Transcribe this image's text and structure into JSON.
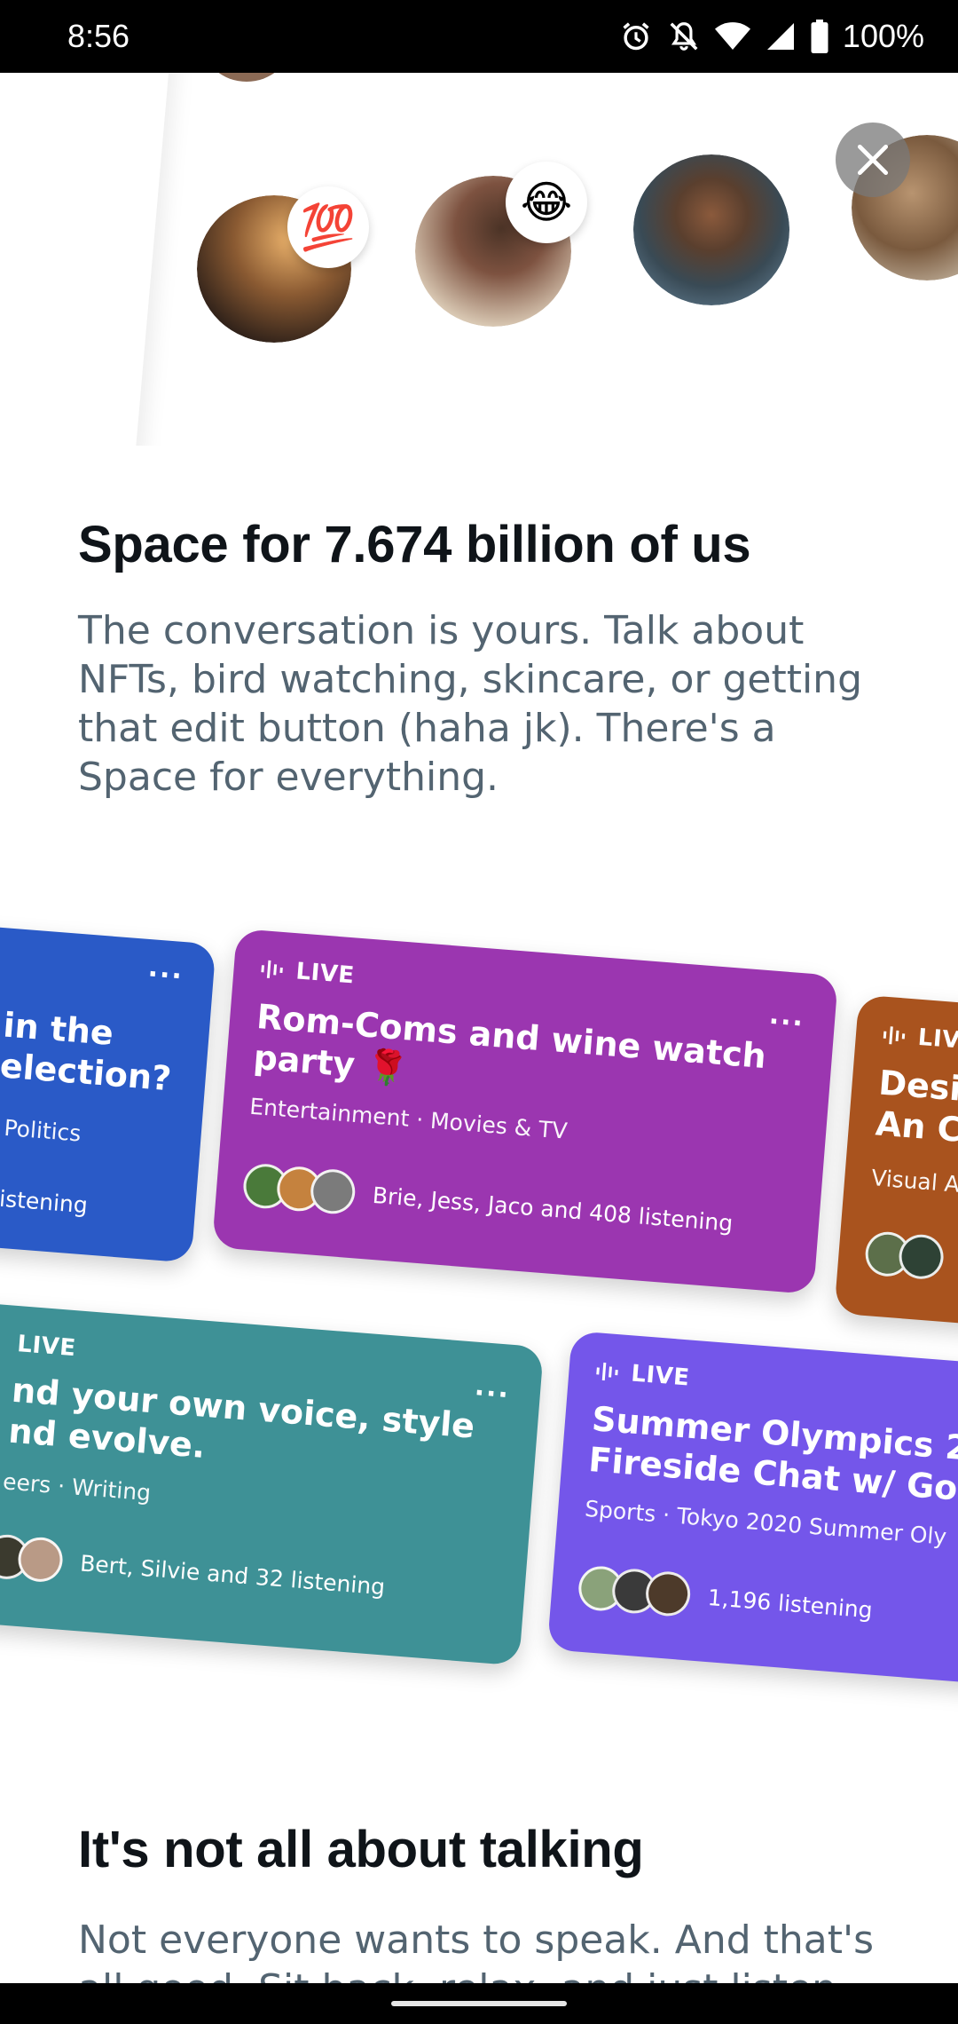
{
  "status_bar": {
    "time": "8:56",
    "battery": "100%",
    "icons": [
      "alarm-icon",
      "mute-icon",
      "wifi-icon",
      "signal-icon",
      "battery-icon"
    ]
  },
  "hero": {
    "badges": [
      "💯",
      "😂"
    ],
    "close_label": "Close"
  },
  "section1": {
    "title": "Space for 7.674 billion of us",
    "body": "The conversation is yours. Talk about NFTs, bird watching, skincare, or getting that edit button (haha jk). There's a Space for everything."
  },
  "cards": [
    {
      "live": "",
      "title": "in the election?",
      "category": "Politics",
      "listening": "listening",
      "more": "···",
      "color": "#2a5ac7"
    },
    {
      "live": "LIVE",
      "title": "Rom-Coms and wine watch party 🌹",
      "category": "Entertainment · Movies & TV",
      "listening": "Brie, Jess, Jaco and 408 listening",
      "more": "···",
      "color": "#9b36b0"
    },
    {
      "live": "LIV",
      "title": "Desi An C",
      "category": "Visual A",
      "listening": "",
      "more": "",
      "color": "#a9531e"
    },
    {
      "live": "LIVE",
      "title": "nd your own voice, style nd evolve.",
      "category": "eers · Writing",
      "listening": "Bert, Silvie and 32 listening",
      "more": "···",
      "color": "#3e9196"
    },
    {
      "live": "LIVE",
      "title": "Summer Olympics 2 Fireside Chat w/ Go",
      "category": "Sports · Tokyo 2020 Summer Oly",
      "listening": "1,196 listening",
      "more": "",
      "color": "#7456ea"
    }
  ],
  "section2": {
    "title": "It's not all about talking",
    "body": "Not everyone wants to speak. And that's all good. Sit back, relax, and just listen. If"
  },
  "colors": {
    "heading": "#0f1419",
    "body": "#536471"
  }
}
